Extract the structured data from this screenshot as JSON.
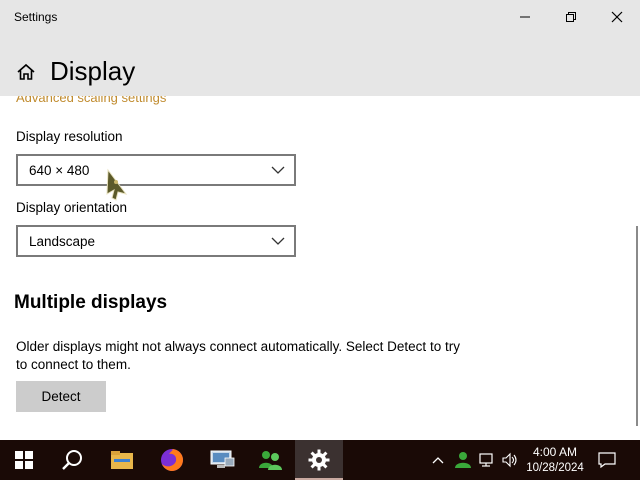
{
  "window": {
    "title": "Settings",
    "controls": {
      "minimize": "minimize",
      "maximize": "maximize",
      "close": "close"
    }
  },
  "header": {
    "title": "Display",
    "home_icon": "home-icon"
  },
  "content": {
    "advanced_scaling_link": "Advanced scaling settings",
    "resolution": {
      "label": "Display resolution",
      "value": "640 × 480"
    },
    "orientation": {
      "label": "Display orientation",
      "value": "Landscape"
    },
    "multiple_displays": {
      "heading": "Multiple displays",
      "description": "Older displays might not always connect automatically. Select Detect to try to connect to them.",
      "detect_label": "Detect"
    }
  },
  "taskbar": {
    "apps": [
      "start",
      "search",
      "file-explorer",
      "firefox",
      "remote-desktop",
      "network-people",
      "settings"
    ],
    "active_app": "settings",
    "clock": {
      "time": "4:00 AM",
      "date": "10/28/2024"
    }
  },
  "colors": {
    "accent_link": "#c08b2e",
    "taskbar": "#1a0a06",
    "titlebar": "#e6e6e6"
  }
}
